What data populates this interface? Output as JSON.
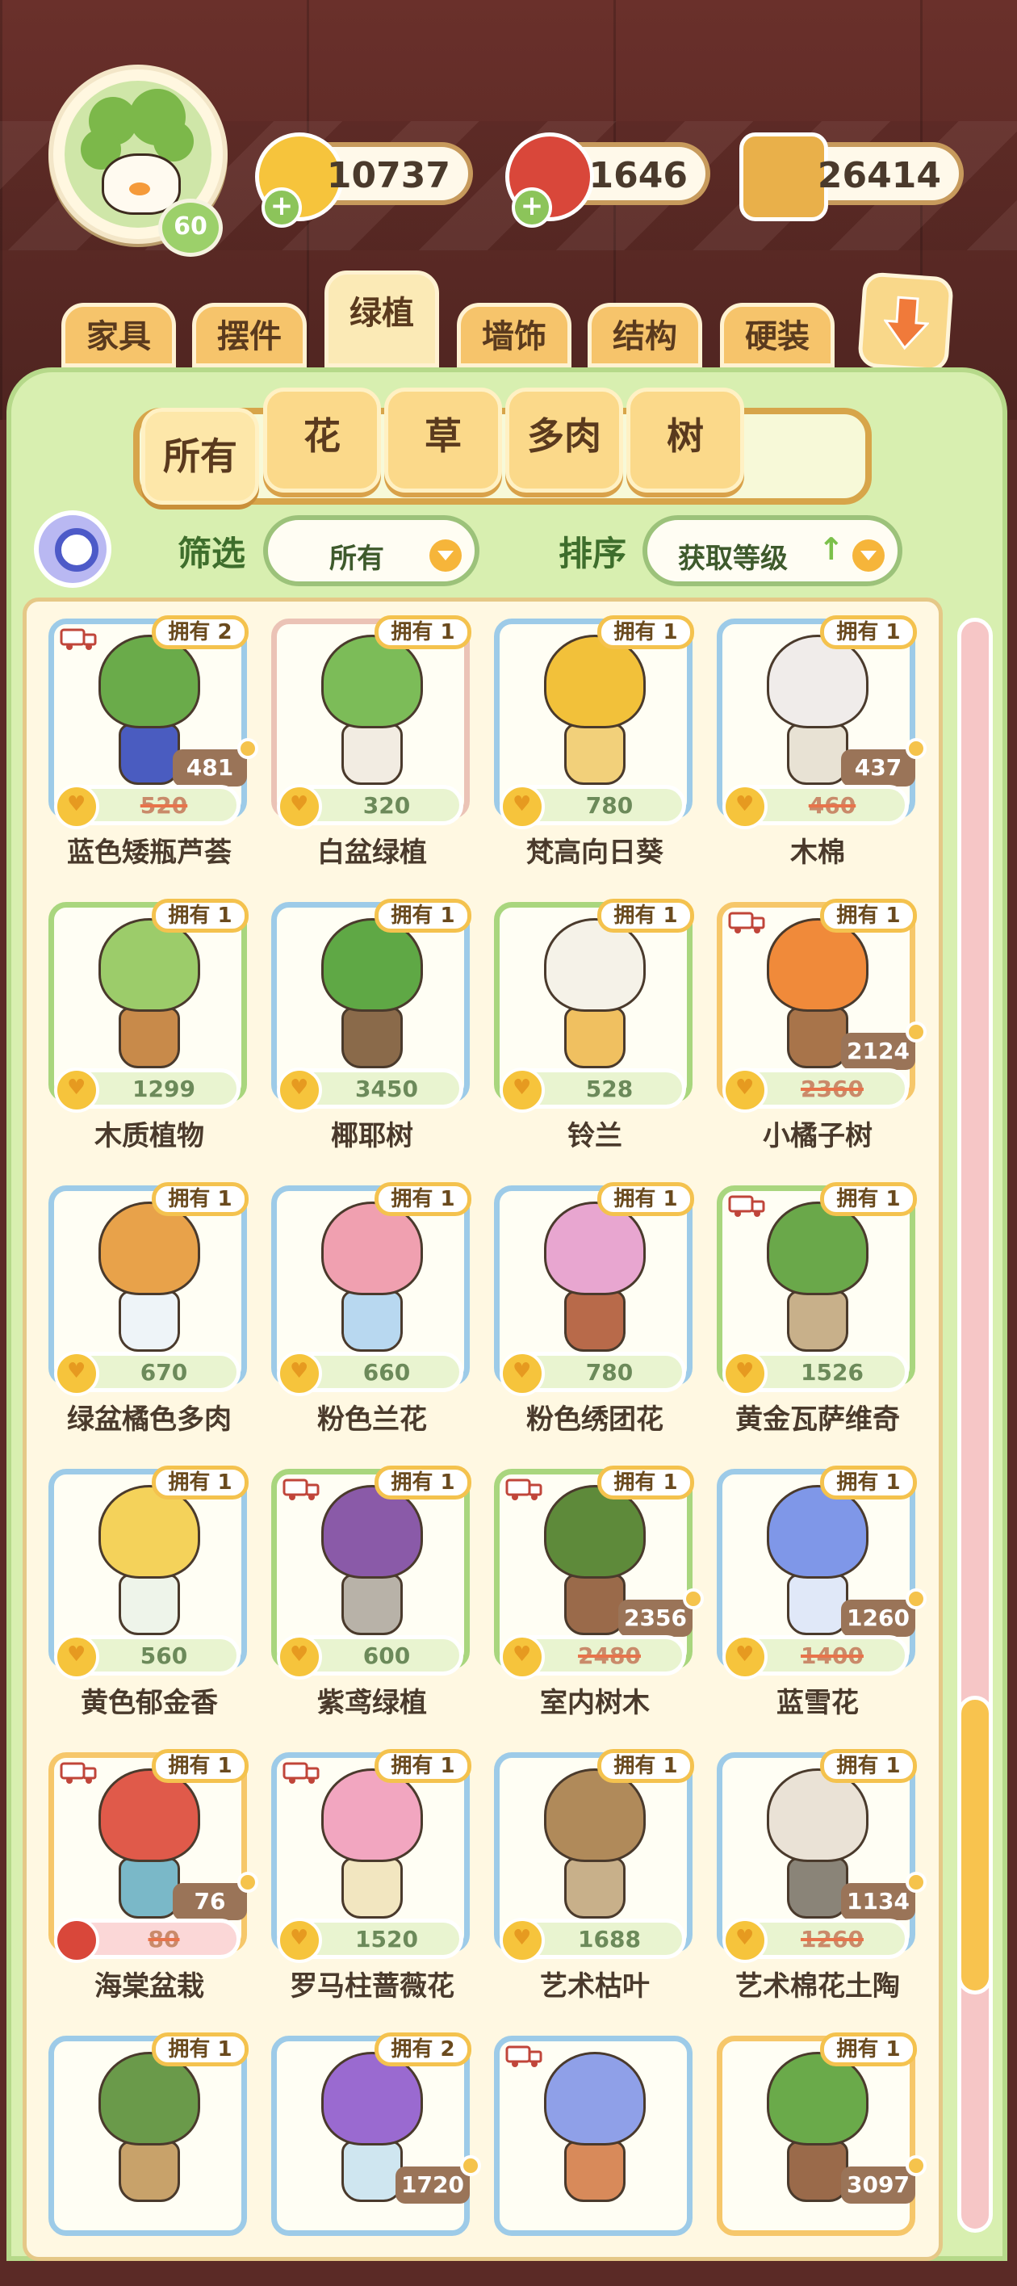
{
  "player": {
    "level": "60"
  },
  "currencies": [
    {
      "name": "coins",
      "value": "10737",
      "color": "#f6c43c"
    },
    {
      "name": "berries",
      "value": "1646",
      "color": "#d9473a"
    },
    {
      "name": "tickets",
      "value": "26414",
      "color": "#e9b04a"
    }
  ],
  "category_tabs": [
    "家具",
    "摆件",
    "绿植",
    "墙饰",
    "结构",
    "硬装"
  ],
  "active_category": "绿植",
  "sub_tabs": [
    "所有",
    "花",
    "草",
    "多肉",
    "树"
  ],
  "active_sub_tab": "所有",
  "filter": {
    "label": "筛选",
    "value": "所有"
  },
  "sort": {
    "label": "排序",
    "value": "获取等级",
    "arrow": "↑"
  },
  "items": [
    {
      "name": "蓝色矮瓶芦荟",
      "owned": "拥有 2",
      "price": "520",
      "sale_price": "481",
      "truck": true,
      "frame": "blue"
    },
    {
      "name": "白盆绿植",
      "owned": "拥有 1",
      "price": "320",
      "sale_price": "",
      "truck": false,
      "frame": "pink"
    },
    {
      "name": "梵高向日葵",
      "owned": "拥有 1",
      "price": "780",
      "sale_price": "",
      "truck": false,
      "frame": "blue"
    },
    {
      "name": "木棉",
      "owned": "拥有 1",
      "price": "460",
      "sale_price": "437",
      "truck": false,
      "frame": "blue"
    },
    {
      "name": "木质植物",
      "owned": "拥有 1",
      "price": "1299",
      "sale_price": "",
      "truck": false,
      "frame": "green"
    },
    {
      "name": "椰耶树",
      "owned": "拥有 1",
      "price": "3450",
      "sale_price": "",
      "truck": false,
      "frame": "blue"
    },
    {
      "name": "铃兰",
      "owned": "拥有 1",
      "price": "528",
      "sale_price": "",
      "truck": false,
      "frame": "green"
    },
    {
      "name": "小橘子树",
      "owned": "拥有 1",
      "price": "2360",
      "sale_price": "2124",
      "truck": true,
      "frame": "orange"
    },
    {
      "name": "绿盆橘色多肉",
      "owned": "拥有 1",
      "price": "670",
      "sale_price": "",
      "truck": false,
      "frame": "blue"
    },
    {
      "name": "粉色兰花",
      "owned": "拥有 1",
      "price": "660",
      "sale_price": "",
      "truck": false,
      "frame": "blue"
    },
    {
      "name": "粉色绣团花",
      "owned": "拥有 1",
      "price": "780",
      "sale_price": "",
      "truck": false,
      "frame": "blue"
    },
    {
      "name": "黄金瓦萨维奇",
      "owned": "拥有 1",
      "price": "1526",
      "sale_price": "",
      "truck": true,
      "frame": "green"
    },
    {
      "name": "黄色郁金香",
      "owned": "拥有 1",
      "price": "560",
      "sale_price": "",
      "truck": false,
      "frame": "blue"
    },
    {
      "name": "紫鸢绿植",
      "owned": "拥有 1",
      "price": "600",
      "sale_price": "",
      "truck": true,
      "frame": "green"
    },
    {
      "name": "室内树木",
      "owned": "拥有 1",
      "price": "2480",
      "sale_price": "2356",
      "truck": true,
      "frame": "green"
    },
    {
      "name": "蓝雪花",
      "owned": "拥有 1",
      "price": "1400",
      "sale_price": "1260",
      "truck": false,
      "frame": "blue"
    },
    {
      "name": "海棠盆栽",
      "owned": "拥有 1",
      "price": "80",
      "sale_price": "76",
      "truck": true,
      "frame": "orange",
      "berry": true
    },
    {
      "name": "罗马柱蔷薇花",
      "owned": "拥有 1",
      "price": "1520",
      "sale_price": "",
      "truck": true,
      "frame": "blue"
    },
    {
      "name": "艺术枯叶",
      "owned": "拥有 1",
      "price": "1688",
      "sale_price": "",
      "truck": false,
      "frame": "blue"
    },
    {
      "name": "艺术棉花土陶",
      "owned": "拥有 1",
      "price": "1260",
      "sale_price": "1134",
      "truck": false,
      "frame": "blue"
    },
    {
      "name": "",
      "owned": "拥有 1",
      "price": "",
      "sale_price": "",
      "truck": false,
      "frame": "blue"
    },
    {
      "name": "",
      "owned": "拥有 2",
      "price": "",
      "sale_price": "1720",
      "truck": false,
      "frame": "blue"
    },
    {
      "name": "",
      "owned": "",
      "price": "",
      "sale_price": "",
      "truck": true,
      "frame": "blue"
    },
    {
      "name": "",
      "owned": "拥有 1",
      "price": "",
      "sale_price": "3097",
      "truck": false,
      "frame": "orange"
    }
  ]
}
